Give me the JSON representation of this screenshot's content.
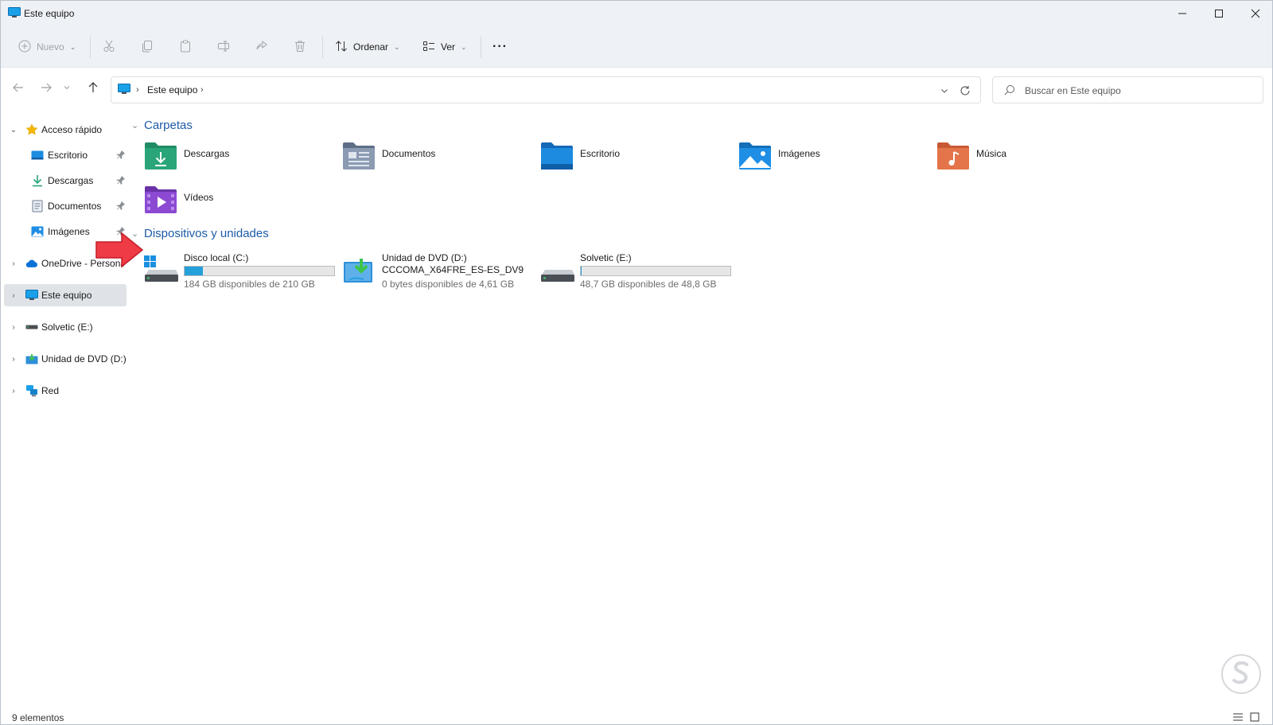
{
  "window": {
    "title": "Este equipo",
    "accent": "#0067c0"
  },
  "toolbar": {
    "new_label": "Nuevo",
    "sort_label": "Ordenar",
    "view_label": "Ver",
    "more_label": "···",
    "icons": [
      "cut-icon",
      "copy-icon",
      "paste-icon",
      "rename-icon",
      "share-icon",
      "delete-icon"
    ]
  },
  "nav": {
    "breadcrumb": "Este equipo",
    "search_placeholder": "Buscar en Este equipo"
  },
  "sidebar": {
    "items": [
      {
        "label": "Acceso rápido",
        "icon": "star-icon"
      },
      {
        "label": "Escritorio",
        "icon": "desktop-icon",
        "pinned": true
      },
      {
        "label": "Descargas",
        "icon": "download-icon",
        "pinned": true
      },
      {
        "label": "Documentos",
        "icon": "document-icon",
        "pinned": true
      },
      {
        "label": "Imágenes",
        "icon": "pictures-icon",
        "pinned": true
      },
      {
        "label": "OneDrive - Personal",
        "icon": "cloud-icon"
      },
      {
        "label": "Este equipo",
        "icon": "pc-icon",
        "selected": true
      },
      {
        "label": "Solvetic (E:)",
        "icon": "drive-icon"
      },
      {
        "label": "Unidad de DVD (D:)",
        "icon": "dvd-icon"
      },
      {
        "label": "Red",
        "icon": "network-icon"
      }
    ]
  },
  "content": {
    "folders_header": "Carpetas",
    "folders": [
      {
        "name": "Descargas",
        "icon": "downloads-folder-icon",
        "color": "#2aa57a"
      },
      {
        "name": "Documentos",
        "icon": "documents-folder-icon",
        "color": "#7b8ea8"
      },
      {
        "name": "Escritorio",
        "icon": "desktop-folder-icon",
        "color": "#1d8ce0"
      },
      {
        "name": "Imágenes",
        "icon": "pictures-folder-icon",
        "color": "#1f8fe6"
      },
      {
        "name": "Música",
        "icon": "music-folder-icon",
        "color": "#e4744a"
      },
      {
        "name": "Vídeos",
        "icon": "videos-folder-icon",
        "color": "#8b4ad1"
      }
    ],
    "devices_header": "Dispositivos y unidades",
    "drives": [
      {
        "name": "Disco local (C:)",
        "free_text": "184 GB disponibles de 210 GB",
        "used_fraction": 0.124,
        "icon": "windows-drive-icon"
      },
      {
        "name": "Unidad de DVD (D:)",
        "label2": "CCCOMA_X64FRE_ES-ES_DV9",
        "free_text": "0 bytes disponibles de 4,61 GB",
        "icon": "dvd-drive-icon"
      },
      {
        "name": "Solvetic (E:)",
        "free_text": "48,7 GB disponibles de 48,8 GB",
        "used_fraction": 0.002,
        "icon": "drive-icon"
      }
    ]
  },
  "status": {
    "count": "9 elementos"
  },
  "colors": {
    "group_header": "#1c5ba8",
    "selection": "#dfe3e8",
    "bar_fill": "#26a0da",
    "annotation_arrow": "#ee3b45"
  }
}
